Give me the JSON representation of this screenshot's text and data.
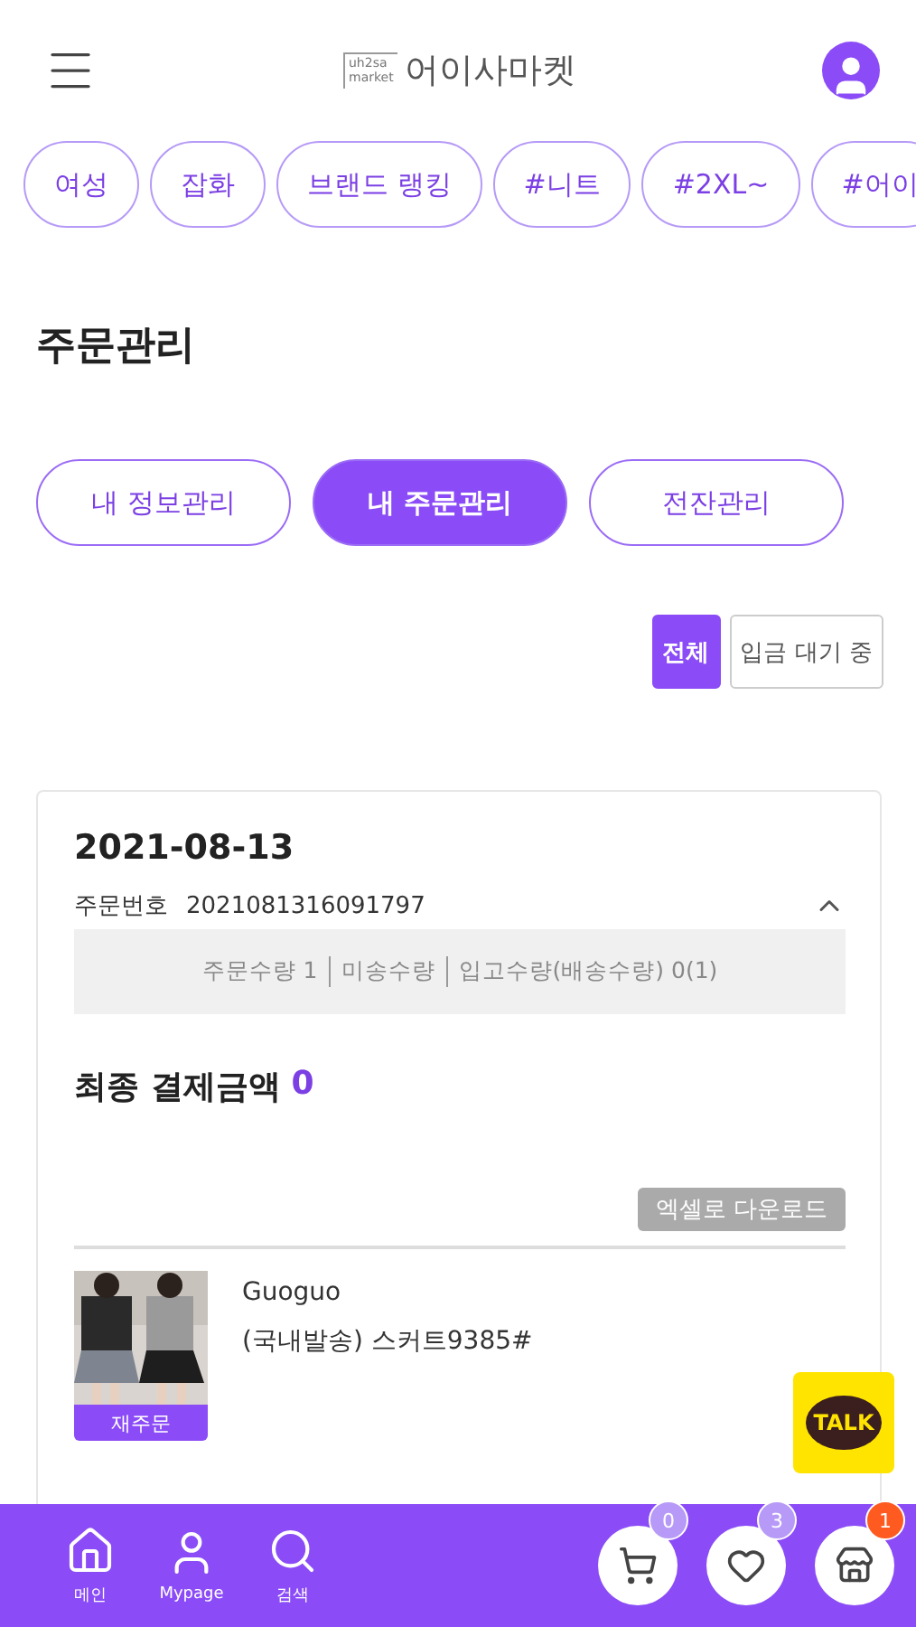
{
  "header": {
    "logo_small": "uh2sa market",
    "logo_text": "어이사마켓"
  },
  "chips": [
    "여성",
    "잡화",
    "브랜드 랭킹",
    "#니트",
    "#2XL~",
    "#어이"
  ],
  "page_title": "주문관리",
  "tabs": [
    {
      "label": "내 정보관리",
      "selected": false
    },
    {
      "label": "내 주문관리",
      "selected": true
    },
    {
      "label": "전잔관리",
      "selected": false
    }
  ],
  "filters": [
    {
      "label": "전체",
      "selected": true
    },
    {
      "label": "입금 대기 중",
      "selected": false
    }
  ],
  "order": {
    "date": "2021-08-13",
    "number_label": "주문번호",
    "number": "2021081316091797",
    "expanded": true,
    "summary": [
      "주문수량 1",
      "미송수량",
      "입고수량(배송수량) 0(1)"
    ],
    "total_label": "최종 결제금액",
    "total": "0",
    "excel_button": "엑셀로 다운로드",
    "item": {
      "reorder": "재주문",
      "brand": "Guoguo",
      "name": "(국내발송) 스커트9385#"
    }
  },
  "talk_button": "TALK",
  "bottom_nav": [
    {
      "label": "메인"
    },
    {
      "label": "Mypage"
    },
    {
      "label": "검색"
    }
  ],
  "quick_buttons": [
    {
      "count": "0",
      "alert": false
    },
    {
      "count": "3",
      "alert": false
    },
    {
      "count": "1",
      "alert": true
    }
  ]
}
